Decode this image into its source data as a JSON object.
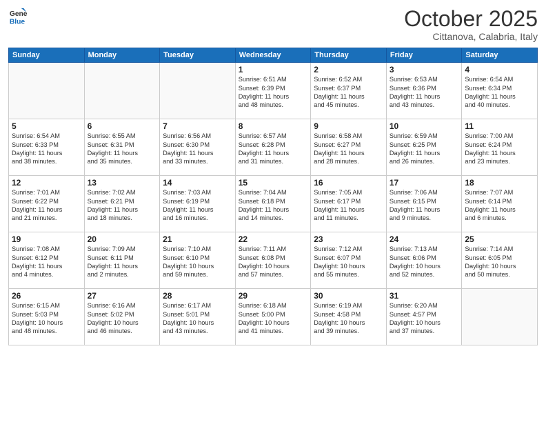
{
  "header": {
    "logo_general": "General",
    "logo_blue": "Blue",
    "title": "October 2025",
    "subtitle": "Cittanova, Calabria, Italy"
  },
  "weekdays": [
    "Sunday",
    "Monday",
    "Tuesday",
    "Wednesday",
    "Thursday",
    "Friday",
    "Saturday"
  ],
  "weeks": [
    [
      {
        "day": "",
        "info": ""
      },
      {
        "day": "",
        "info": ""
      },
      {
        "day": "",
        "info": ""
      },
      {
        "day": "1",
        "info": "Sunrise: 6:51 AM\nSunset: 6:39 PM\nDaylight: 11 hours\nand 48 minutes."
      },
      {
        "day": "2",
        "info": "Sunrise: 6:52 AM\nSunset: 6:37 PM\nDaylight: 11 hours\nand 45 minutes."
      },
      {
        "day": "3",
        "info": "Sunrise: 6:53 AM\nSunset: 6:36 PM\nDaylight: 11 hours\nand 43 minutes."
      },
      {
        "day": "4",
        "info": "Sunrise: 6:54 AM\nSunset: 6:34 PM\nDaylight: 11 hours\nand 40 minutes."
      }
    ],
    [
      {
        "day": "5",
        "info": "Sunrise: 6:54 AM\nSunset: 6:33 PM\nDaylight: 11 hours\nand 38 minutes."
      },
      {
        "day": "6",
        "info": "Sunrise: 6:55 AM\nSunset: 6:31 PM\nDaylight: 11 hours\nand 35 minutes."
      },
      {
        "day": "7",
        "info": "Sunrise: 6:56 AM\nSunset: 6:30 PM\nDaylight: 11 hours\nand 33 minutes."
      },
      {
        "day": "8",
        "info": "Sunrise: 6:57 AM\nSunset: 6:28 PM\nDaylight: 11 hours\nand 31 minutes."
      },
      {
        "day": "9",
        "info": "Sunrise: 6:58 AM\nSunset: 6:27 PM\nDaylight: 11 hours\nand 28 minutes."
      },
      {
        "day": "10",
        "info": "Sunrise: 6:59 AM\nSunset: 6:25 PM\nDaylight: 11 hours\nand 26 minutes."
      },
      {
        "day": "11",
        "info": "Sunrise: 7:00 AM\nSunset: 6:24 PM\nDaylight: 11 hours\nand 23 minutes."
      }
    ],
    [
      {
        "day": "12",
        "info": "Sunrise: 7:01 AM\nSunset: 6:22 PM\nDaylight: 11 hours\nand 21 minutes."
      },
      {
        "day": "13",
        "info": "Sunrise: 7:02 AM\nSunset: 6:21 PM\nDaylight: 11 hours\nand 18 minutes."
      },
      {
        "day": "14",
        "info": "Sunrise: 7:03 AM\nSunset: 6:19 PM\nDaylight: 11 hours\nand 16 minutes."
      },
      {
        "day": "15",
        "info": "Sunrise: 7:04 AM\nSunset: 6:18 PM\nDaylight: 11 hours\nand 14 minutes."
      },
      {
        "day": "16",
        "info": "Sunrise: 7:05 AM\nSunset: 6:17 PM\nDaylight: 11 hours\nand 11 minutes."
      },
      {
        "day": "17",
        "info": "Sunrise: 7:06 AM\nSunset: 6:15 PM\nDaylight: 11 hours\nand 9 minutes."
      },
      {
        "day": "18",
        "info": "Sunrise: 7:07 AM\nSunset: 6:14 PM\nDaylight: 11 hours\nand 6 minutes."
      }
    ],
    [
      {
        "day": "19",
        "info": "Sunrise: 7:08 AM\nSunset: 6:12 PM\nDaylight: 11 hours\nand 4 minutes."
      },
      {
        "day": "20",
        "info": "Sunrise: 7:09 AM\nSunset: 6:11 PM\nDaylight: 11 hours\nand 2 minutes."
      },
      {
        "day": "21",
        "info": "Sunrise: 7:10 AM\nSunset: 6:10 PM\nDaylight: 10 hours\nand 59 minutes."
      },
      {
        "day": "22",
        "info": "Sunrise: 7:11 AM\nSunset: 6:08 PM\nDaylight: 10 hours\nand 57 minutes."
      },
      {
        "day": "23",
        "info": "Sunrise: 7:12 AM\nSunset: 6:07 PM\nDaylight: 10 hours\nand 55 minutes."
      },
      {
        "day": "24",
        "info": "Sunrise: 7:13 AM\nSunset: 6:06 PM\nDaylight: 10 hours\nand 52 minutes."
      },
      {
        "day": "25",
        "info": "Sunrise: 7:14 AM\nSunset: 6:05 PM\nDaylight: 10 hours\nand 50 minutes."
      }
    ],
    [
      {
        "day": "26",
        "info": "Sunrise: 6:15 AM\nSunset: 5:03 PM\nDaylight: 10 hours\nand 48 minutes."
      },
      {
        "day": "27",
        "info": "Sunrise: 6:16 AM\nSunset: 5:02 PM\nDaylight: 10 hours\nand 46 minutes."
      },
      {
        "day": "28",
        "info": "Sunrise: 6:17 AM\nSunset: 5:01 PM\nDaylight: 10 hours\nand 43 minutes."
      },
      {
        "day": "29",
        "info": "Sunrise: 6:18 AM\nSunset: 5:00 PM\nDaylight: 10 hours\nand 41 minutes."
      },
      {
        "day": "30",
        "info": "Sunrise: 6:19 AM\nSunset: 4:58 PM\nDaylight: 10 hours\nand 39 minutes."
      },
      {
        "day": "31",
        "info": "Sunrise: 6:20 AM\nSunset: 4:57 PM\nDaylight: 10 hours\nand 37 minutes."
      },
      {
        "day": "",
        "info": ""
      }
    ]
  ]
}
